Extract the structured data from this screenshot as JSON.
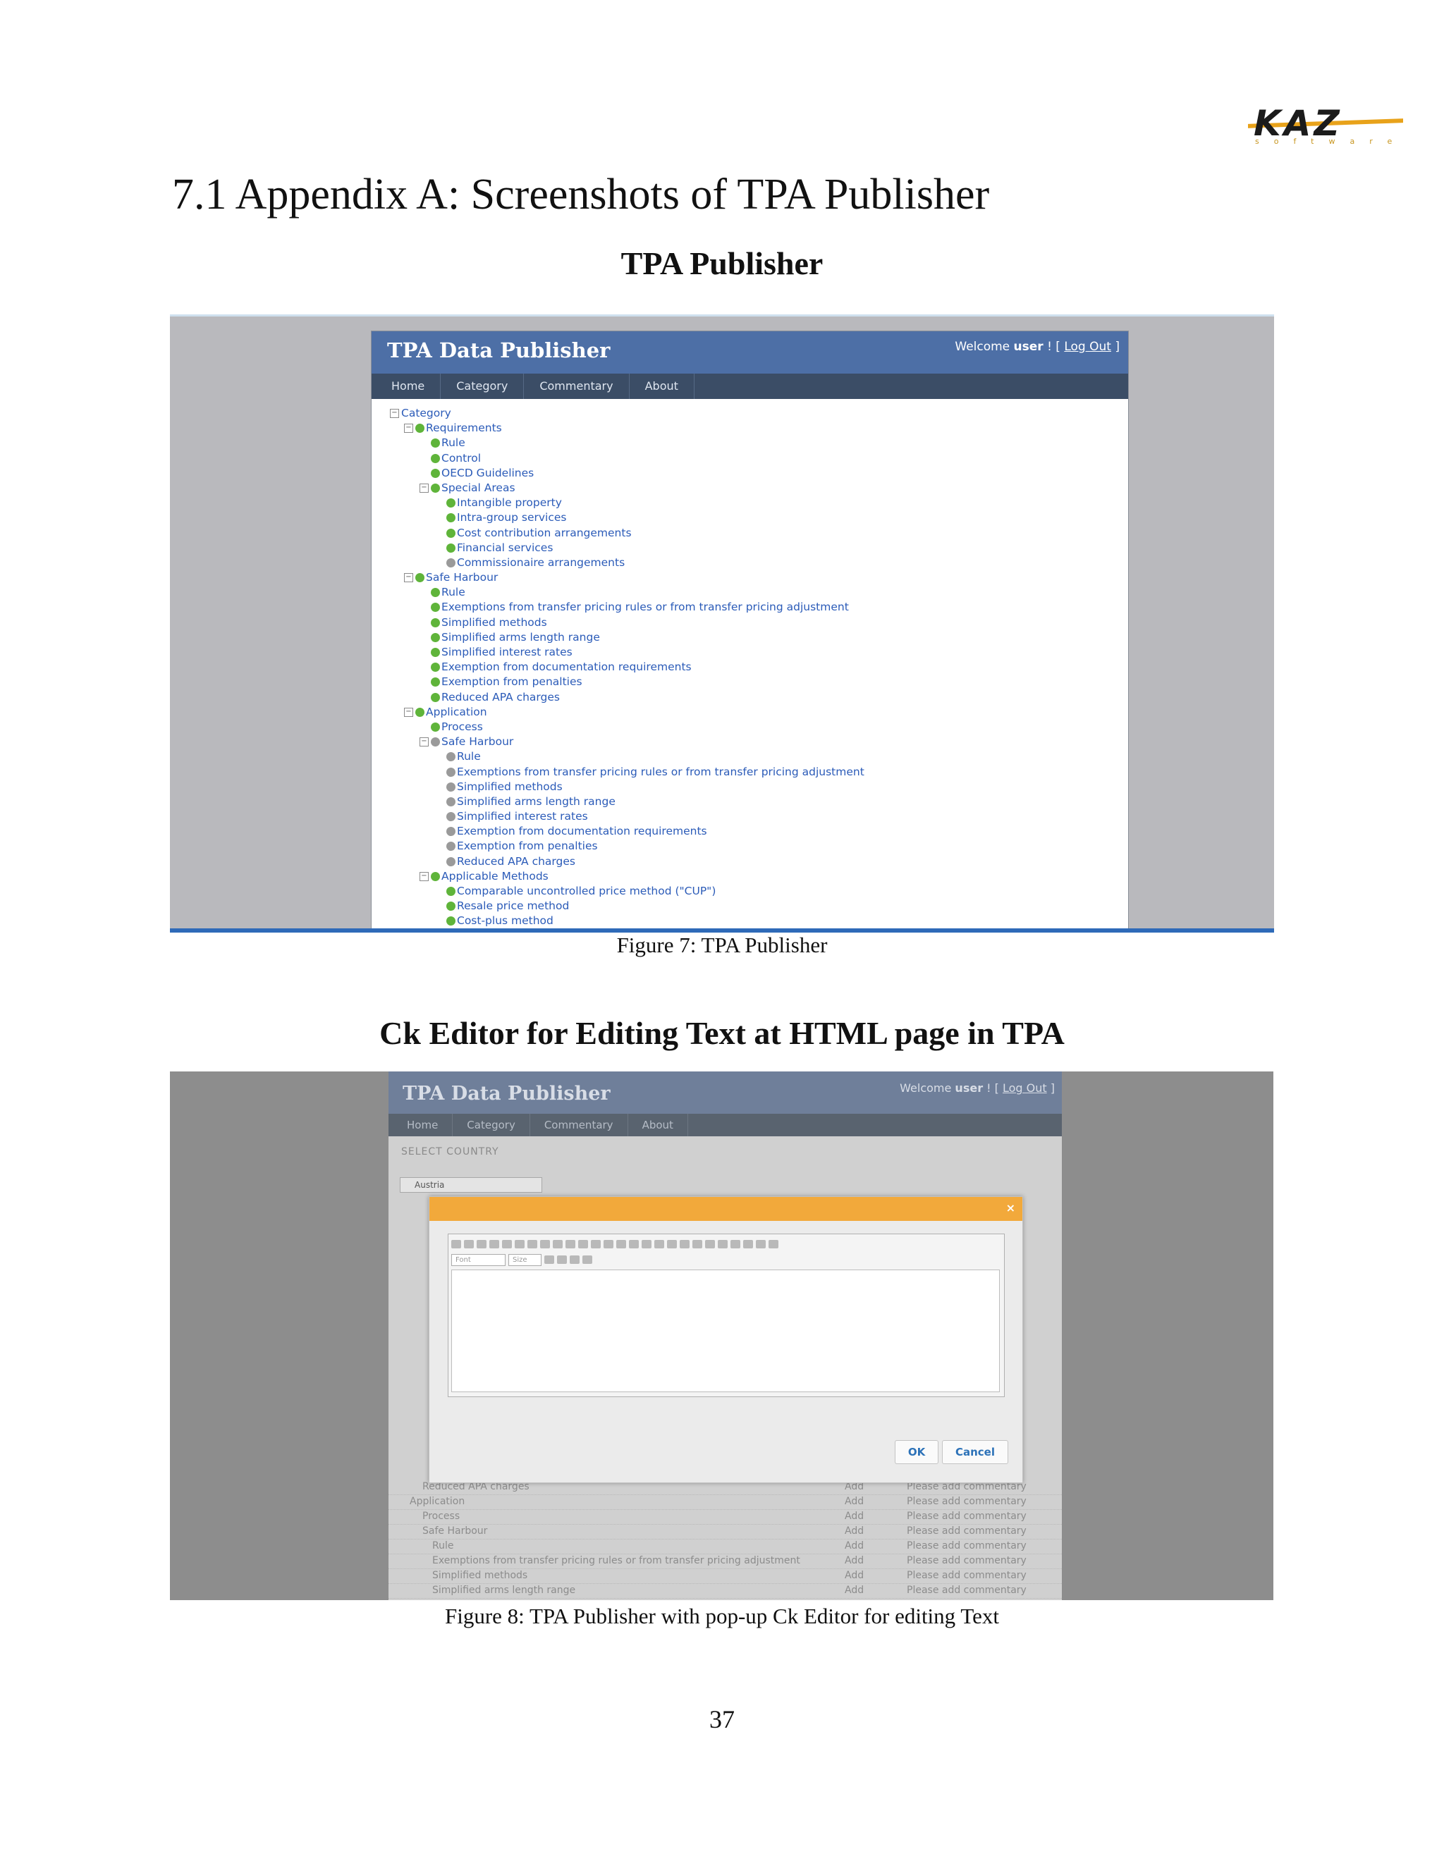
{
  "logo": {
    "main": "KAZ",
    "sub": "software"
  },
  "heading": "7.1 Appendix A: Screenshots of TPA Publisher",
  "section1_title": "TPA Publisher",
  "figure7": {
    "caption": "Figure 7: TPA Publisher",
    "app_title": "TPA Data Publisher",
    "welcome_prefix": "Welcome",
    "user": "user",
    "logout": "Log Out",
    "nav": [
      "Home",
      "Category",
      "Commentary",
      "About"
    ],
    "tree": [
      {
        "label": "Category",
        "level": 0,
        "expander": true,
        "check": "none"
      },
      {
        "label": "Requirements",
        "level": 1,
        "expander": true,
        "check": "green"
      },
      {
        "label": "Rule",
        "level": 2,
        "expander": false,
        "check": "green"
      },
      {
        "label": "Control",
        "level": 2,
        "expander": false,
        "check": "green"
      },
      {
        "label": "OECD Guidelines",
        "level": 2,
        "expander": false,
        "check": "green"
      },
      {
        "label": "Special Areas",
        "level": 2,
        "expander": true,
        "check": "green"
      },
      {
        "label": "Intangible property",
        "level": 3,
        "expander": false,
        "check": "green"
      },
      {
        "label": "Intra-group services",
        "level": 3,
        "expander": false,
        "check": "green"
      },
      {
        "label": "Cost contribution arrangements",
        "level": 3,
        "expander": false,
        "check": "green"
      },
      {
        "label": "Financial services",
        "level": 3,
        "expander": false,
        "check": "green"
      },
      {
        "label": "Commissionaire arrangements",
        "level": 3,
        "expander": false,
        "check": "gray"
      },
      {
        "label": "Safe Harbour",
        "level": 1,
        "expander": true,
        "check": "green"
      },
      {
        "label": "Rule",
        "level": 2,
        "expander": false,
        "check": "green"
      },
      {
        "label": "Exemptions from transfer pricing rules or from transfer pricing adjustment",
        "level": 2,
        "expander": false,
        "check": "green"
      },
      {
        "label": "Simplified methods",
        "level": 2,
        "expander": false,
        "check": "green"
      },
      {
        "label": "Simplified arms length range",
        "level": 2,
        "expander": false,
        "check": "green"
      },
      {
        "label": "Simplified interest rates",
        "level": 2,
        "expander": false,
        "check": "green"
      },
      {
        "label": "Exemption from documentation requirements",
        "level": 2,
        "expander": false,
        "check": "green"
      },
      {
        "label": "Exemption from penalties",
        "level": 2,
        "expander": false,
        "check": "green"
      },
      {
        "label": "Reduced APA charges",
        "level": 2,
        "expander": false,
        "check": "green"
      },
      {
        "label": "Application",
        "level": 1,
        "expander": true,
        "check": "green"
      },
      {
        "label": "Process",
        "level": 2,
        "expander": false,
        "check": "green"
      },
      {
        "label": "Safe Harbour",
        "level": 2,
        "expander": true,
        "check": "gray"
      },
      {
        "label": "Rule",
        "level": 3,
        "expander": false,
        "check": "gray"
      },
      {
        "label": "Exemptions from transfer pricing rules or from transfer pricing adjustment",
        "level": 3,
        "expander": false,
        "check": "gray"
      },
      {
        "label": "Simplified methods",
        "level": 3,
        "expander": false,
        "check": "gray"
      },
      {
        "label": "Simplified arms length range",
        "level": 3,
        "expander": false,
        "check": "gray"
      },
      {
        "label": "Simplified interest rates",
        "level": 3,
        "expander": false,
        "check": "gray"
      },
      {
        "label": "Exemption from documentation requirements",
        "level": 3,
        "expander": false,
        "check": "gray"
      },
      {
        "label": "Exemption from penalties",
        "level": 3,
        "expander": false,
        "check": "gray"
      },
      {
        "label": "Reduced APA charges",
        "level": 3,
        "expander": false,
        "check": "gray"
      },
      {
        "label": "Applicable Methods",
        "level": 2,
        "expander": true,
        "check": "green"
      },
      {
        "label": "Comparable uncontrolled price method (\"CUP\")",
        "level": 3,
        "expander": false,
        "check": "green"
      },
      {
        "label": "Resale price method",
        "level": 3,
        "expander": false,
        "check": "green"
      },
      {
        "label": "Cost-plus method",
        "level": 3,
        "expander": false,
        "check": "green"
      }
    ]
  },
  "section2_title": "Ck Editor for Editing Text at HTML page in TPA",
  "figure8": {
    "caption": "Figure 8: TPA Publisher with pop-up Ck Editor for editing Text",
    "app_title": "TPA Data Publisher",
    "welcome_prefix": "Welcome",
    "user": "user",
    "logout": "Log Out",
    "nav": [
      "Home",
      "Category",
      "Commentary",
      "About"
    ],
    "select_country_label": "SELECT COUNTRY",
    "country_value": "Austria",
    "toolbar_font": "Font",
    "toolbar_size": "Size",
    "ok_label": "OK",
    "cancel_label": "Cancel",
    "close_symbol": "×",
    "rows": [
      {
        "label": "Reduced APA charges",
        "level": 2,
        "add": "Add",
        "commentary": "Please add commentary"
      },
      {
        "label": "Application",
        "level": 1,
        "add": "Add",
        "commentary": "Please add commentary"
      },
      {
        "label": "Process",
        "level": 2,
        "add": "Add",
        "commentary": "Please add commentary"
      },
      {
        "label": "Safe Harbour",
        "level": 2,
        "add": "Add",
        "commentary": "Please add commentary"
      },
      {
        "label": "Rule",
        "level": 3,
        "add": "Add",
        "commentary": "Please add commentary"
      },
      {
        "label": "Exemptions from transfer pricing rules or from transfer pricing adjustment",
        "level": 3,
        "add": "Add",
        "commentary": "Please add commentary"
      },
      {
        "label": "Simplified methods",
        "level": 3,
        "add": "Add",
        "commentary": "Please add commentary"
      },
      {
        "label": "Simplified arms length range",
        "level": 3,
        "add": "Add",
        "commentary": "Please add commentary"
      }
    ]
  },
  "page_number": "37"
}
